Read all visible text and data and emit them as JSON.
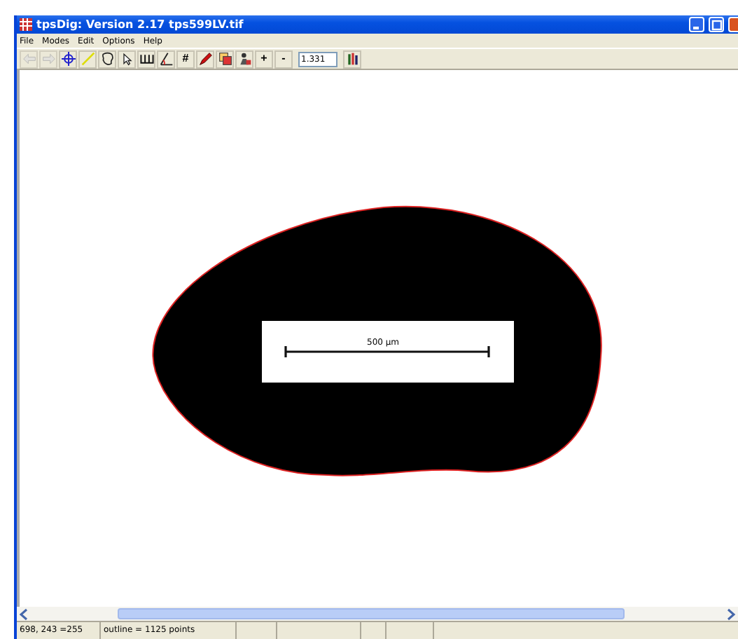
{
  "window": {
    "title": "tpsDig: Version 2.17 tps599LV.tif"
  },
  "menu": [
    "File",
    "Modes",
    "Edit",
    "Options",
    "Help"
  ],
  "toolbar": [
    {
      "kind": "back",
      "disabled": true
    },
    {
      "kind": "forward",
      "disabled": true
    },
    {
      "kind": "crosshair",
      "disabled": false
    },
    {
      "kind": "line",
      "disabled": false
    },
    {
      "kind": "outline",
      "disabled": false
    },
    {
      "kind": "pointer",
      "disabled": false
    },
    {
      "kind": "comb",
      "disabled": false
    },
    {
      "kind": "angle",
      "disabled": false
    },
    {
      "kind": "text",
      "label": "#",
      "disabled": false
    },
    {
      "kind": "pen",
      "disabled": false
    },
    {
      "kind": "copy",
      "disabled": false
    },
    {
      "kind": "figure",
      "disabled": false
    },
    {
      "kind": "text",
      "label": "+",
      "disabled": false
    },
    {
      "kind": "text",
      "label": "-",
      "disabled": false
    },
    {
      "kind": "field",
      "value": "1.331"
    },
    {
      "kind": "chart",
      "disabled": false
    }
  ],
  "canvas": {
    "scale_label": "500 µm"
  },
  "status_bar": [
    "698, 243 =255",
    "outline = 1125 points"
  ]
}
